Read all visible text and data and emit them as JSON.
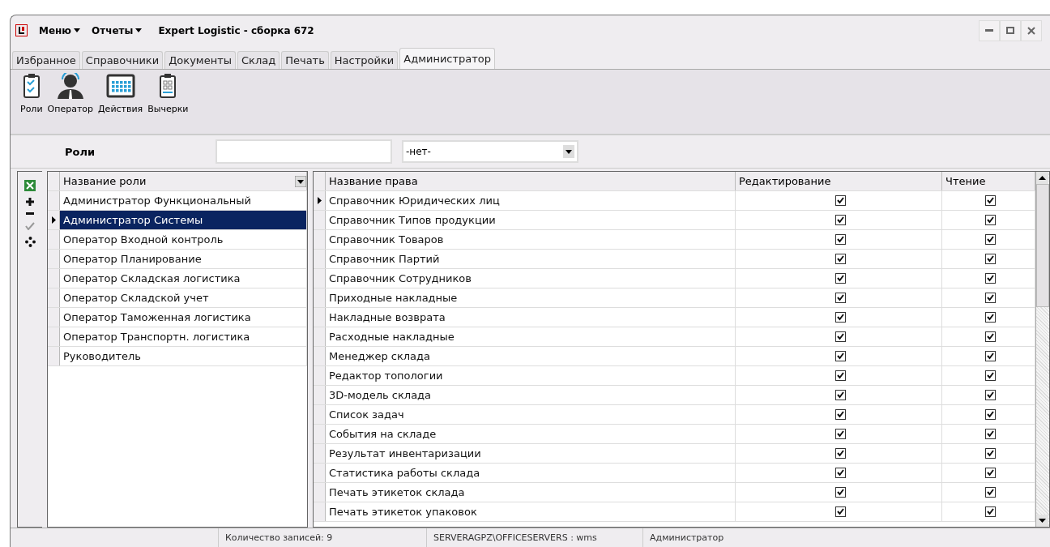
{
  "menu": [
    "Меню",
    "Отчеты"
  ],
  "window": {
    "title": "Expert Logistic - сборка 672"
  },
  "tabs": [
    {
      "label": "Избранное",
      "selected": false
    },
    {
      "label": "Справочники",
      "selected": false
    },
    {
      "label": "Документы",
      "selected": false
    },
    {
      "label": "Склад",
      "selected": false
    },
    {
      "label": "Печать",
      "selected": false
    },
    {
      "label": "Настройки",
      "selected": false
    },
    {
      "label": "Администратор",
      "selected": true
    }
  ],
  "toolbar": [
    {
      "label": "Роли",
      "kind": "roles"
    },
    {
      "label": "Оператор",
      "kind": "operator"
    },
    {
      "label": "Действия",
      "kind": "calendar"
    },
    {
      "label": "Вычерки",
      "kind": "list"
    }
  ],
  "filter": {
    "label": "Роли",
    "dropdown": "-нет-"
  },
  "roles": {
    "column": "Название роли",
    "rows": [
      {
        "name": "Администратор Функциональный",
        "selected": false
      },
      {
        "name": "Администратор Системы",
        "selected": true
      },
      {
        "name": "Оператор Входной контроль",
        "selected": false
      },
      {
        "name": "Оператор Планирование",
        "selected": false
      },
      {
        "name": "Оператор Складская логистика",
        "selected": false
      },
      {
        "name": "Оператор Складской учет",
        "selected": false
      },
      {
        "name": "Оператор Таможенная логистика",
        "selected": false
      },
      {
        "name": "Оператор Транспортн. логистика",
        "selected": false
      },
      {
        "name": "Руководитель",
        "selected": false
      }
    ]
  },
  "rights": {
    "columns": [
      "Название права",
      "Редактирование",
      "Чтение"
    ],
    "rows": [
      {
        "name": "Справочник Юридических лиц",
        "edit": true,
        "read": true,
        "selected": true
      },
      {
        "name": "Справочник Типов продукции",
        "edit": true,
        "read": true,
        "selected": false
      },
      {
        "name": "Справочник Товаров",
        "edit": true,
        "read": true,
        "selected": false
      },
      {
        "name": "Справочник Партий",
        "edit": true,
        "read": true,
        "selected": false
      },
      {
        "name": "Справочник Сотрудников",
        "edit": true,
        "read": true,
        "selected": false
      },
      {
        "name": "Приходные накладные",
        "edit": true,
        "read": true,
        "selected": false
      },
      {
        "name": "Накладные возврата",
        "edit": true,
        "read": true,
        "selected": false
      },
      {
        "name": "Расходные накладные",
        "edit": true,
        "read": true,
        "selected": false
      },
      {
        "name": "Менеджер склада",
        "edit": true,
        "read": true,
        "selected": false
      },
      {
        "name": "Редактор топологии",
        "edit": true,
        "read": true,
        "selected": false
      },
      {
        "name": "3D-модель склада",
        "edit": true,
        "read": true,
        "selected": false
      },
      {
        "name": "Список задач",
        "edit": true,
        "read": true,
        "selected": false
      },
      {
        "name": "События на складе",
        "edit": true,
        "read": true,
        "selected": false
      },
      {
        "name": "Результат инвентаризации",
        "edit": true,
        "read": true,
        "selected": false
      },
      {
        "name": "Статистика работы склада",
        "edit": true,
        "read": true,
        "selected": false
      },
      {
        "name": "Печать этикеток склада",
        "edit": true,
        "read": true,
        "selected": false
      },
      {
        "name": "Печать этикеток упаковок",
        "edit": true,
        "read": true,
        "selected": false
      }
    ]
  },
  "status_bar": [
    "Количество записей: 9",
    "SERVERAGPZ\\OFFICESERVERS : wms",
    "Администратор"
  ]
}
